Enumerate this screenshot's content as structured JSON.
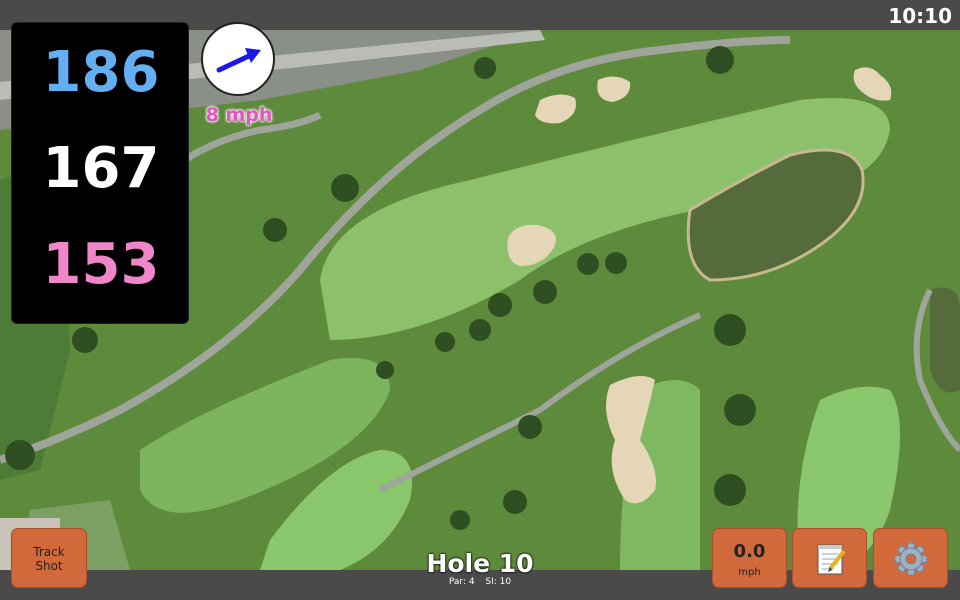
{
  "status": {
    "time": "10:10"
  },
  "yardages": {
    "back": "186",
    "middle": "167",
    "front": "153"
  },
  "wind": {
    "speed_label": "8 mph",
    "direction_icon": "arrow-icon"
  },
  "hole": {
    "title": "Hole 10",
    "par_label": "Par: 4",
    "si_label": "SI: 10"
  },
  "buttons": {
    "track_line1": "Track",
    "track_line2": "Shot",
    "speed_value": "0.0",
    "speed_unit": "mph",
    "notes_icon": "notepad-icon",
    "settings_icon": "gear-icon"
  },
  "colors": {
    "back": "#64aef2",
    "middle": "#ffffff",
    "front": "#ef86c9",
    "wind_text": "#e055c0",
    "button": "#d2693a"
  }
}
